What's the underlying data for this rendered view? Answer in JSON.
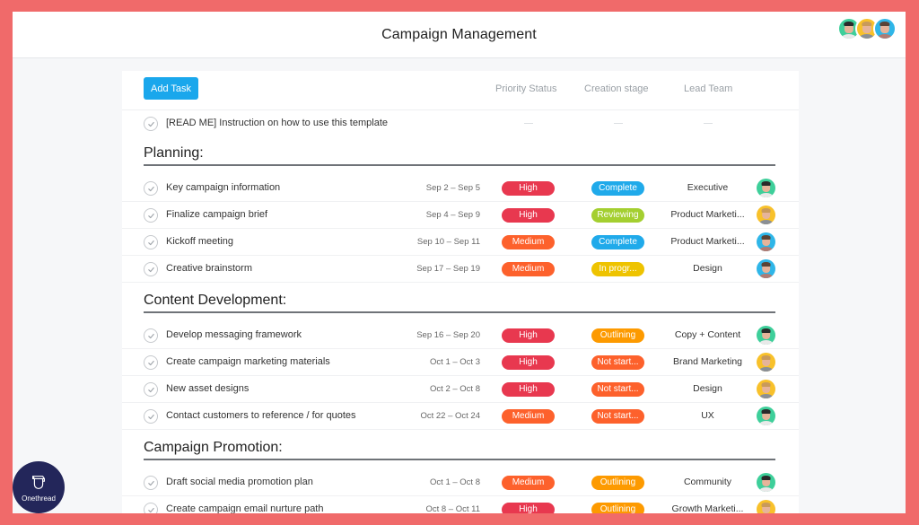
{
  "header": {
    "title": "Campaign Management",
    "members": [
      {
        "name": "member-1",
        "bg": "#3ecf9a",
        "hair": "#2a2a2a",
        "shirt": "#e9e9e9"
      },
      {
        "name": "member-2",
        "bg": "#f8c12b",
        "hair": "#c99a5b",
        "shirt": "#8a8f96"
      },
      {
        "name": "member-3",
        "bg": "#2fb6e8",
        "hair": "#5a4436",
        "shirt": "#b07b73"
      }
    ]
  },
  "toolbar": {
    "add_task_label": "Add Task",
    "columns": [
      "Priority Status",
      "Creation stage",
      "Lead Team"
    ]
  },
  "readme_task": {
    "name": "[READ ME] Instruction on how to use this template",
    "priority": "—",
    "stage": "—",
    "team": "—"
  },
  "colors": {
    "high": "#e8384f",
    "medium": "#fd612c",
    "complete": "#20aaea",
    "reviewing": "#a4cf30",
    "in_progress": "#eec300",
    "outlining": "#fd9a00",
    "not_started": "#fd612c",
    "accent": "#1aa7ec"
  },
  "sections": [
    {
      "title": "Planning:",
      "tasks": [
        {
          "name": "Key campaign information",
          "dates": "Sep 2 – Sep 5",
          "priority": "High",
          "priority_key": "high",
          "stage": "Complete",
          "stage_key": "complete",
          "team": "Executive",
          "assignee": 0
        },
        {
          "name": "Finalize campaign brief",
          "dates": "Sep 4 – Sep 9",
          "priority": "High",
          "priority_key": "high",
          "stage": "Reviewing",
          "stage_key": "reviewing",
          "team": "Product Marketi...",
          "assignee": 1
        },
        {
          "name": "Kickoff meeting",
          "dates": "Sep 10 – Sep 11",
          "priority": "Medium",
          "priority_key": "medium",
          "stage": "Complete",
          "stage_key": "complete",
          "team": "Product Marketi...",
          "assignee": 2
        },
        {
          "name": "Creative brainstorm",
          "dates": "Sep 17 – Sep 19",
          "priority": "Medium",
          "priority_key": "medium",
          "stage": "In progr...",
          "stage_key": "in_progress",
          "team": "Design",
          "assignee": 2
        }
      ]
    },
    {
      "title": "Content Development:",
      "tasks": [
        {
          "name": "Develop messaging framework",
          "dates": "Sep 16 – Sep 20",
          "priority": "High",
          "priority_key": "high",
          "stage": "Outlining",
          "stage_key": "outlining",
          "team": "Copy + Content",
          "assignee": 0
        },
        {
          "name": "Create campaign marketing materials",
          "dates": "Oct 1 – Oct 3",
          "priority": "High",
          "priority_key": "high",
          "stage": "Not start...",
          "stage_key": "not_started",
          "team": "Brand Marketing",
          "assignee": 1
        },
        {
          "name": "New asset designs",
          "dates": "Oct 2 – Oct 8",
          "priority": "High",
          "priority_key": "high",
          "stage": "Not start...",
          "stage_key": "not_started",
          "team": "Design",
          "assignee": 1
        },
        {
          "name": "Contact customers to reference / for quotes",
          "dates": "Oct 22 – Oct 24",
          "priority": "Medium",
          "priority_key": "medium",
          "stage": "Not start...",
          "stage_key": "not_started",
          "team": "UX",
          "assignee": 0
        }
      ]
    },
    {
      "title": "Campaign Promotion:",
      "tasks": [
        {
          "name": "Draft social media promotion plan",
          "dates": "Oct 1 – Oct 8",
          "priority": "Medium",
          "priority_key": "medium",
          "stage": "Outlining",
          "stage_key": "outlining",
          "team": "Community",
          "assignee": 0
        },
        {
          "name": "Create campaign email nurture path",
          "dates": "Oct 8 – Oct 11",
          "priority": "High",
          "priority_key": "high",
          "stage": "Outlining",
          "stage_key": "outlining",
          "team": "Growth Marketi...",
          "assignee": 1
        }
      ]
    }
  ],
  "brand_badge": {
    "label": "Onethread"
  }
}
